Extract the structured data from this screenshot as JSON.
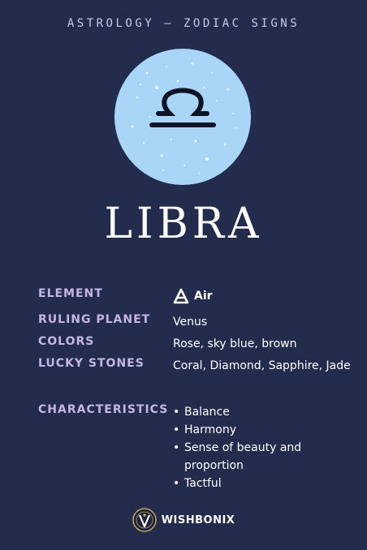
{
  "header": {
    "text": "ASTROLOGY – ZODIAC SIGNS"
  },
  "sign": {
    "name": "LIBRA",
    "symbol_icon": "libra-symbol-icon",
    "emblem_color": "#a9d6f6"
  },
  "facts": {
    "element": {
      "label": "ELEMENT",
      "value": "Air",
      "icon": "air-element-icon"
    },
    "ruling_planet": {
      "label": "RULING PLANET",
      "value": "Venus"
    },
    "colors": {
      "label": "COLORS",
      "value": "Rose, sky blue, brown"
    },
    "lucky_stones": {
      "label": "LUCKY STONES",
      "value": "Coral, Diamond, Sapphire, Jade"
    },
    "characteristics": {
      "label": "CHARACTERISTICS",
      "items": [
        "Balance",
        "Harmony",
        "Sense of beauty and proportion",
        "Tactful"
      ]
    }
  },
  "footer": {
    "brand": "WISHBONIX",
    "logo_icon": "wishbonix-logo-icon"
  },
  "colors": {
    "background": "#232c4d",
    "label": "#c3b6e6",
    "header": "#c8cce0"
  }
}
